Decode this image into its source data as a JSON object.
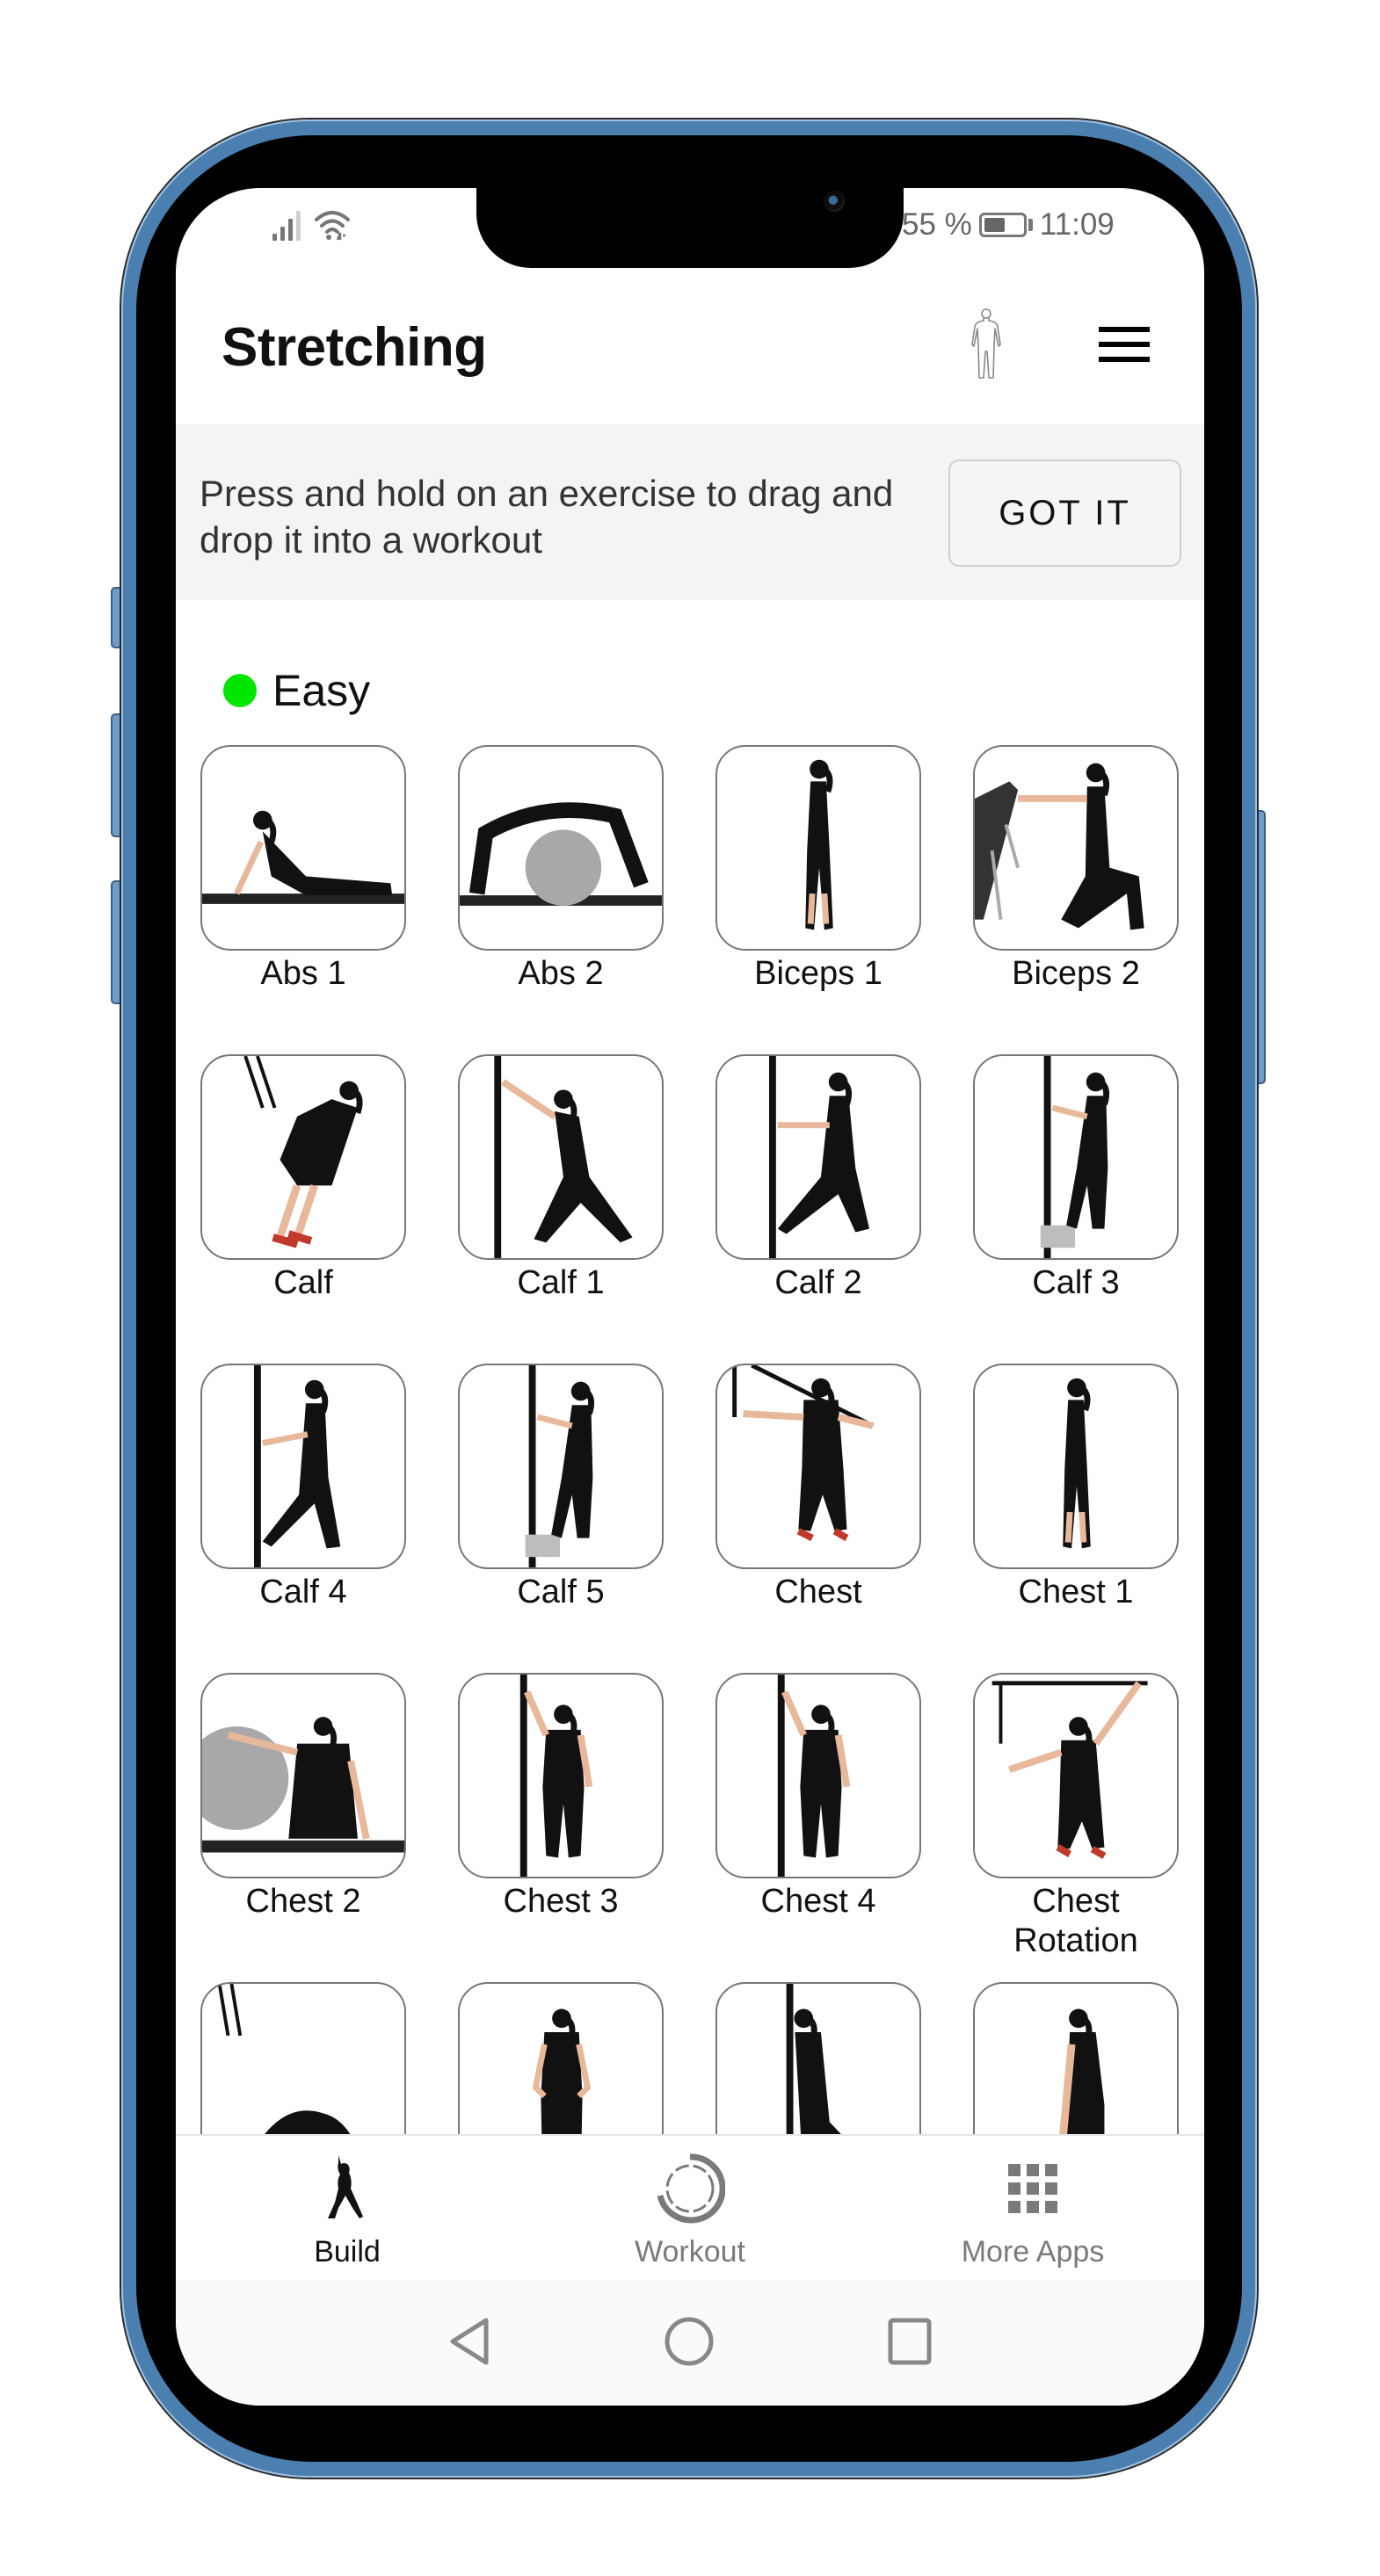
{
  "status_bar": {
    "battery_text": "55 %",
    "battery_level": 0.55,
    "time": "11:09",
    "signal_icon": "signal-icon",
    "wifi_icon": "wifi-icon"
  },
  "header": {
    "title": "Stretching",
    "body_icon": "human-body-icon",
    "menu_icon": "hamburger-menu-icon"
  },
  "banner": {
    "text": "Press and hold on an exercise to drag and drop it into a workout",
    "button_label": "GOT IT"
  },
  "section": {
    "label": "Easy",
    "dot_color": "#00e600"
  },
  "exercises": [
    {
      "name": "Abs 1",
      "pose": "cobra"
    },
    {
      "name": "Abs 2",
      "pose": "ball-arch"
    },
    {
      "name": "Biceps 1",
      "pose": "standing-side"
    },
    {
      "name": "Biceps 2",
      "pose": "kneel-bench"
    },
    {
      "name": "Calf",
      "pose": "trx-lean"
    },
    {
      "name": "Calf 1",
      "pose": "wall-push"
    },
    {
      "name": "Calf 2",
      "pose": "pole-lunge"
    },
    {
      "name": "Calf 3",
      "pose": "pole-step"
    },
    {
      "name": "Calf 4",
      "pose": "pole-walk"
    },
    {
      "name": "Calf 5",
      "pose": "pole-step"
    },
    {
      "name": "Chest",
      "pose": "trx-stand"
    },
    {
      "name": "Chest 1",
      "pose": "standing-side"
    },
    {
      "name": "Chest 2",
      "pose": "ball-kneel"
    },
    {
      "name": "Chest 3",
      "pose": "pole-front"
    },
    {
      "name": "Chest 4",
      "pose": "pole-front"
    },
    {
      "name": "Chest Rotation",
      "pose": "trx-overhead"
    },
    {
      "name": "",
      "pose": "trx-child"
    },
    {
      "name": "",
      "pose": "standing-front"
    },
    {
      "name": "",
      "pose": "pole-sit"
    },
    {
      "name": "",
      "pose": "bench-lean"
    }
  ],
  "bottom_nav": [
    {
      "label": "Build",
      "icon": "build-figure-icon",
      "active": true
    },
    {
      "label": "Workout",
      "icon": "workout-ring-icon",
      "active": false
    },
    {
      "label": "More Apps",
      "icon": "grid-apps-icon",
      "active": false
    }
  ],
  "system_nav": {
    "back": "back-icon",
    "home": "home-icon",
    "recents": "recents-icon"
  },
  "colors": {
    "frame": "#4a7fb0",
    "active_tab": "#111111",
    "inactive_tab": "#7a7a7a",
    "banner_bg": "#f4f4f4"
  }
}
